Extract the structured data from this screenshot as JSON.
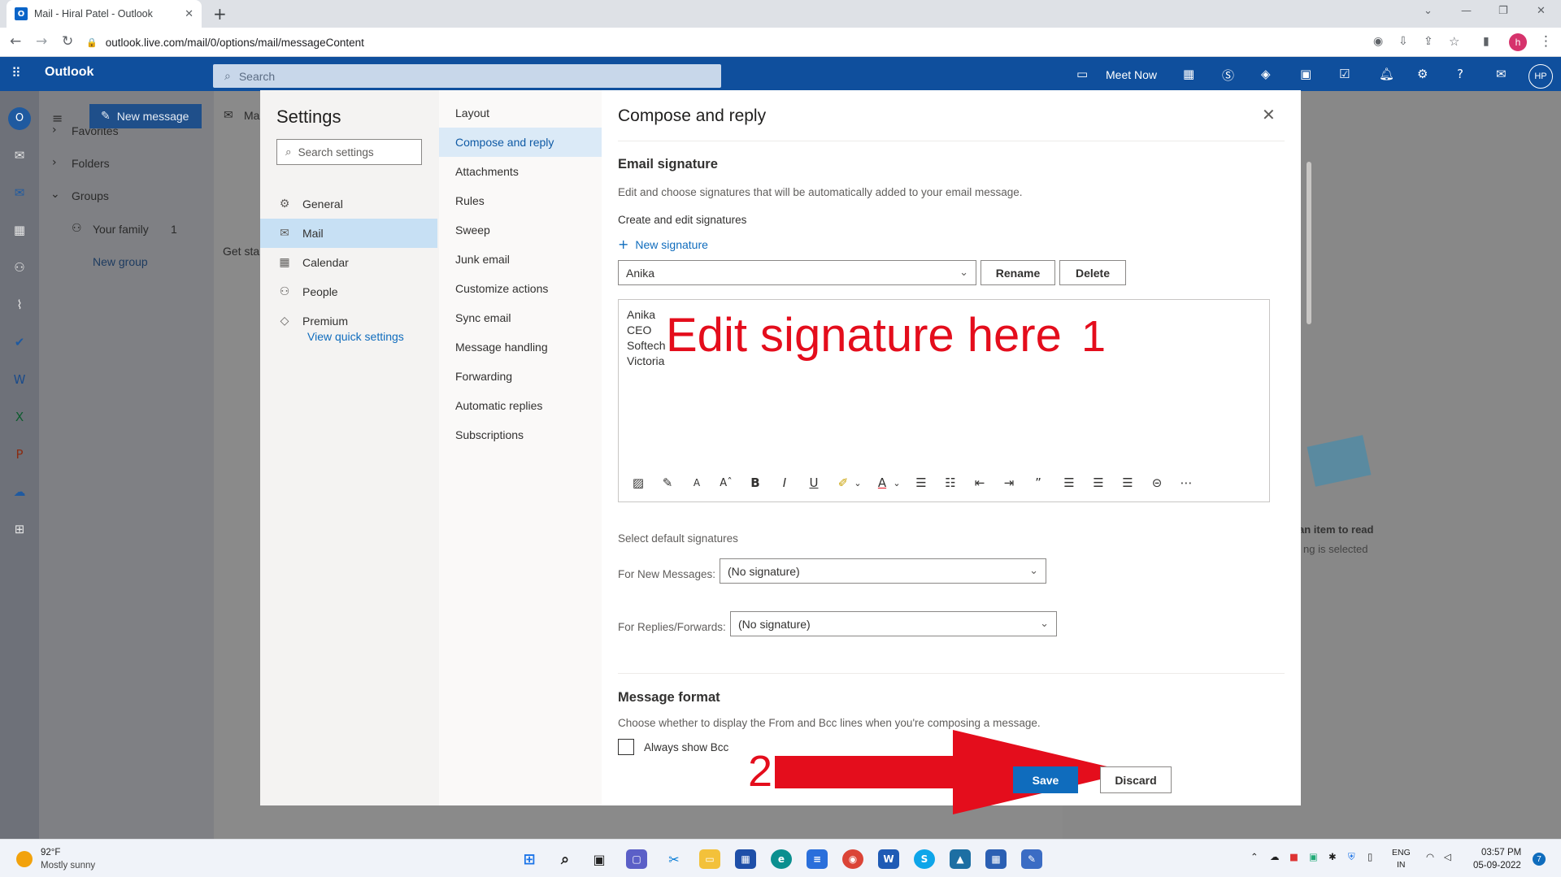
{
  "browser": {
    "tab_title": "Mail - Hiral Patel - Outlook",
    "tab_icon": "O",
    "url": "outlook.live.com/mail/0/options/mail/messageContent",
    "profile_initial": "h"
  },
  "outlook": {
    "app_name": "Outlook",
    "search_placeholder": "Search",
    "meet_now": "Meet Now",
    "avatar": "HP",
    "new_message": "New message",
    "folder_tab": "Ma",
    "favorites": "Favorites",
    "folders": "Folders",
    "groups": "Groups",
    "your_family": "Your family",
    "your_family_count": "1",
    "new_group": "New group",
    "get_started": "Get sta",
    "reading_line1": "an item to read",
    "reading_line2": "ng is selected"
  },
  "settings": {
    "title": "Settings",
    "search_placeholder": "Search settings",
    "nav": [
      {
        "label": "General",
        "icon": "gear-icon"
      },
      {
        "label": "Mail",
        "icon": "mail-icon"
      },
      {
        "label": "Calendar",
        "icon": "calendar-icon"
      },
      {
        "label": "People",
        "icon": "people-icon"
      },
      {
        "label": "Premium",
        "icon": "diamond-icon"
      }
    ],
    "view_quick_settings": "View quick settings",
    "sub_nav": [
      "Layout",
      "Compose and reply",
      "Attachments",
      "Rules",
      "Sweep",
      "Junk email",
      "Customize actions",
      "Sync email",
      "Message handling",
      "Forwarding",
      "Automatic replies",
      "Subscriptions"
    ],
    "selected_nav": "Mail",
    "selected_sub": "Compose and reply"
  },
  "compose": {
    "title": "Compose and reply",
    "email_signature_heading": "Email signature",
    "email_signature_desc": "Edit and choose signatures that will be automatically added to your email message.",
    "create_edit": "Create and edit signatures",
    "new_signature": "New signature",
    "signature_name": "Anika",
    "rename": "Rename",
    "delete": "Delete",
    "signature_lines": [
      "Anika",
      "CEO",
      "Softech",
      "Victoria"
    ],
    "select_defaults": "Select default signatures",
    "for_new_label": "For New Messages:",
    "for_new_value": "(No signature)",
    "for_replies_label": "For Replies/Forwards:",
    "for_replies_value": "(No signature)",
    "message_format_heading": "Message format",
    "message_format_desc": "Choose whether to display the From and Bcc lines when you're composing a message.",
    "always_show_bcc": "Always show Bcc",
    "save": "Save",
    "discard": "Discard"
  },
  "annotations": {
    "edit_here": "Edit signature here",
    "step1": "1",
    "step2": "2",
    "color": "#e40d1c"
  },
  "taskbar": {
    "temperature": "92°F",
    "weather": "Mostly sunny",
    "lang1": "ENG",
    "lang2": "IN",
    "time": "03:57 PM",
    "date": "05-09-2022",
    "notif_count": "7"
  },
  "colors": {
    "accent": "#0f6cbd",
    "outlook_bar": "#0f4f9d",
    "selected_nav": "#c7e0f4"
  }
}
